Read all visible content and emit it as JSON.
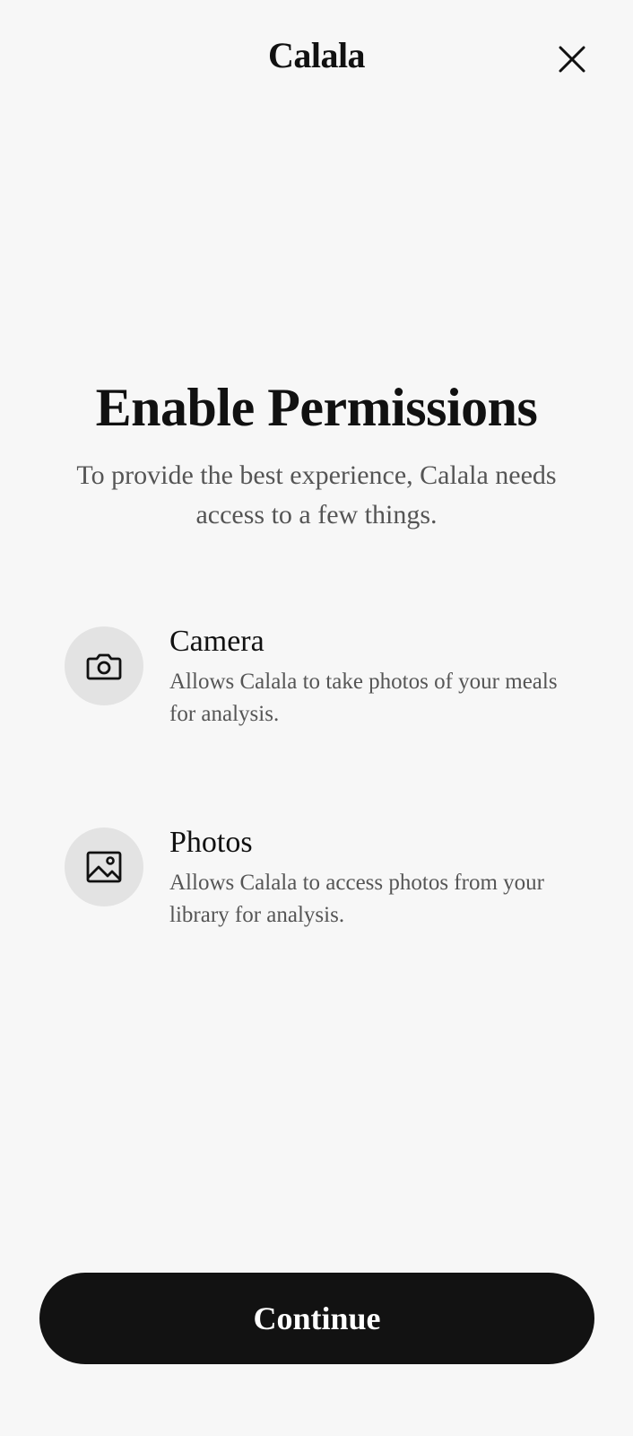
{
  "header": {
    "app_title": "Calala",
    "close_icon": "close-icon"
  },
  "hero": {
    "title": "Enable Permissions",
    "subtitle": "To provide the best experience, Calala needs access to a few things."
  },
  "permissions": [
    {
      "icon": "camera-icon",
      "title": "Camera",
      "description": "Allows Calala to take photos of your meals for analysis."
    },
    {
      "icon": "image-icon",
      "title": "Photos",
      "description": "Allows Calala to access photos from your library for analysis."
    }
  ],
  "footer": {
    "continue_label": "Continue"
  },
  "colors": {
    "background": "#f7f7f7",
    "icon_circle": "#e3e3e3",
    "button": "#121212",
    "button_text": "#ffffff",
    "secondary_text": "#555555"
  }
}
